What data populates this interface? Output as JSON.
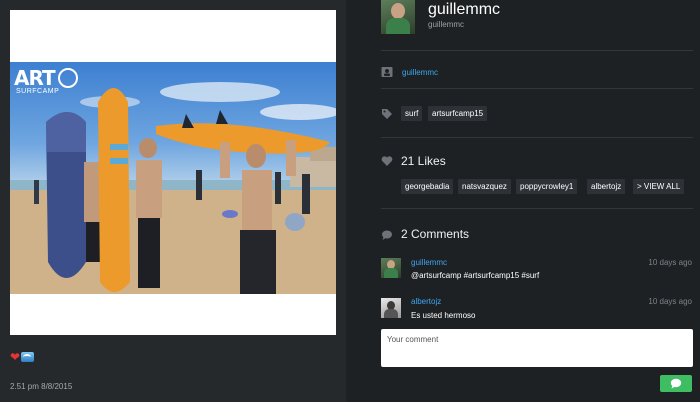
{
  "post": {
    "logo_text": "ART",
    "logo_subtext": "SURFCAMP",
    "emoji": [
      "heart",
      "wave"
    ],
    "timestamp": "2.51 pm 8/8/2015"
  },
  "user": {
    "name": "guillemmc",
    "handle": "guillemmc"
  },
  "owner": {
    "link": "guillemmc"
  },
  "tags": [
    "surf",
    "artsurfcamp15"
  ],
  "likes": {
    "title": "21 Likes",
    "users": [
      "georgebadia",
      "natsvazquez",
      "poppycrowley1",
      "albertojz"
    ],
    "view_all": "> VIEW ALL"
  },
  "comments": {
    "title": "2 Comments",
    "items": [
      {
        "author": "guillemmc",
        "time": "10 days ago",
        "text": "@artsurfcamp #artsurfcamp15 #surf"
      },
      {
        "author": "albertojz",
        "time": "10 days ago",
        "text": "Es usted hermoso"
      }
    ],
    "input_placeholder": "Your comment"
  },
  "colors": {
    "accent_link": "#3ea6f0",
    "send_button": "#3fbd63",
    "background": "#1e2124"
  }
}
